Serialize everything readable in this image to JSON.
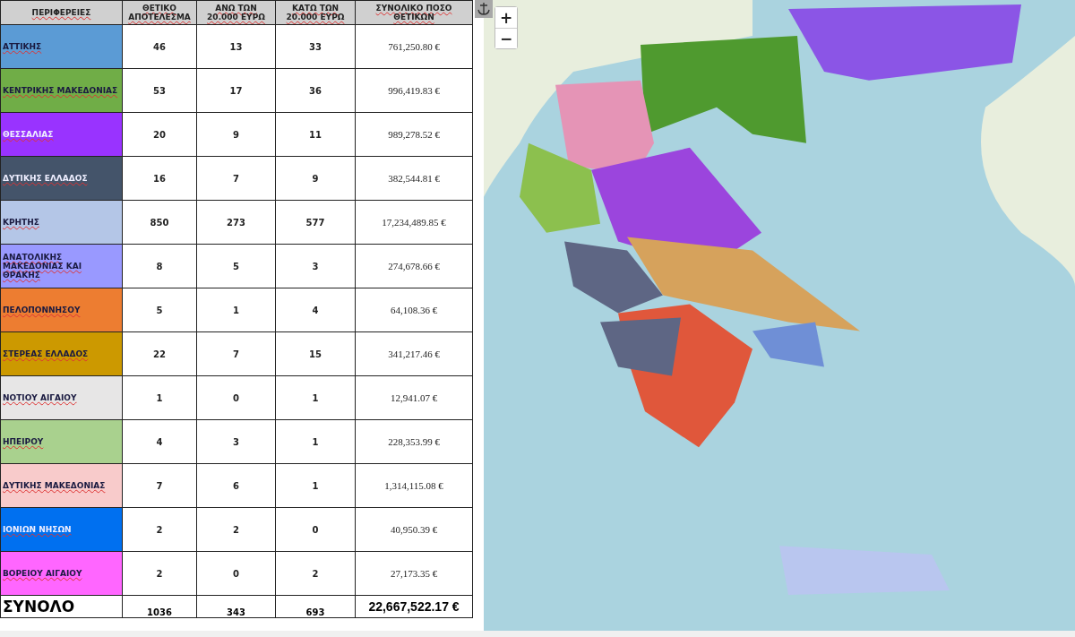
{
  "table": {
    "columns": [
      "ΠΕΡΙΦΕΡΕΙΕΣ",
      "ΘΕΤΙΚΟ ΑΠΟΤΕΛΕΣΜΑ",
      "ΑΝΩ ΤΩΝ 20.000 ΕΥΡΩ",
      "ΚΑΤΩ ΤΩΝ 20.000 ΕΥΡΩ",
      "ΣΥΝΟΛΙΚΟ ΠΟΣΟ ΘΕΤΙΚΩΝ"
    ],
    "rows": [
      {
        "color": "#5b9bd5",
        "cells": [
          "ΑΤΤΙΚΗΣ",
          "46",
          "13",
          "33",
          "761,250.80 €"
        ]
      },
      {
        "color": "#70ad47",
        "cells": [
          "ΚΕΝΤΡΙΚΗΣ  ΜΑΚΕΔΟΝΙΑΣ",
          "53",
          "17",
          "36",
          "996,419.83 €"
        ]
      },
      {
        "color": "#9933ff",
        "cells": [
          "ΘΕΣΣΑΛΙΑΣ",
          "20",
          "9",
          "11",
          "989,278.52 €"
        ]
      },
      {
        "color": "#44546a",
        "cells": [
          "ΔΥΤΙΚΗΣ ΕΛΛΑΔΟΣ",
          "16",
          "7",
          "9",
          "382,544.81 €"
        ]
      },
      {
        "color": "#b4c6e7",
        "cells": [
          "ΚΡΗΤΗΣ",
          "850",
          "273",
          "577",
          "17,234,489.85 €"
        ]
      },
      {
        "color": "#9999ff",
        "cells": [
          "ΑΝΑΤΟΛΙΚΗΣ ΜΑΚΕΔΟΝΙΑΣ ΚΑΙ ΘΡΑΚΗΣ",
          "8",
          "5",
          "3",
          "274,678.66 €"
        ]
      },
      {
        "color": "#ed7d31",
        "cells": [
          "ΠΕΛΟΠΟΝΝΗΣΟΥ",
          "5",
          "1",
          "4",
          "64,108.36 €"
        ]
      },
      {
        "color": "#cc9900",
        "cells": [
          "ΣΤΕΡΕΑΣ ΕΛΛΑΔΟΣ",
          "22",
          "7",
          "15",
          "341,217.46 €"
        ]
      },
      {
        "color": "#e7e6e6",
        "cells": [
          "ΝΟΤΙΟΥ ΑΙΓΑΙΟΥ",
          "1",
          "0",
          "1",
          "12,941.07 €"
        ]
      },
      {
        "color": "#a9d18e",
        "cells": [
          "ΗΠΕΙΡΟΥ",
          "4",
          "3",
          "1",
          "228,353.99 €"
        ]
      },
      {
        "color": "#f8cbcb",
        "cells": [
          "ΔΥΤΙΚΗΣ ΜΑΚΕΔΟΝΙΑΣ",
          "7",
          "6",
          "1",
          "1,314,115.08 €"
        ]
      },
      {
        "color": "#0070f0",
        "cells": [
          "ΙΟΝΙΩΝ ΝΗΣΩΝ",
          "2",
          "2",
          "0",
          "40,950.39 €"
        ]
      },
      {
        "color": "#ff66ff",
        "cells": [
          "ΒΟΡΕΙΟΥ ΑΙΓΑΙΟΥ",
          "2",
          "0",
          "2",
          "27,173.35 €"
        ]
      }
    ],
    "total": {
      "cells": [
        "ΣΥΝΟΛΟ",
        "1036",
        "343",
        "693",
        "22,667,522.17 €"
      ]
    }
  },
  "map": {
    "zoom_in": "+",
    "zoom_out": "−"
  }
}
